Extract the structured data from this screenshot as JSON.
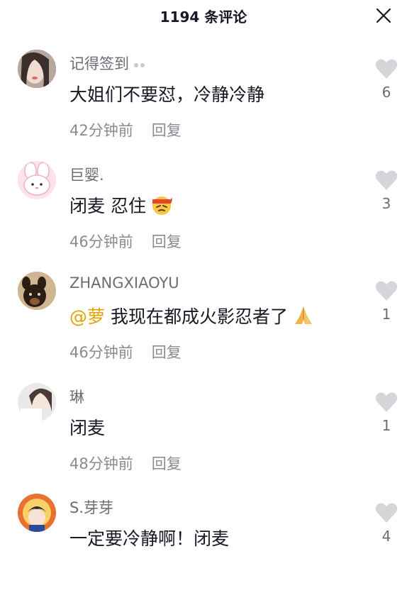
{
  "header": {
    "title": "1194 条评论"
  },
  "comments": [
    {
      "username": "记得签到",
      "text": "大姐们不要怼，冷静冷静",
      "time": "42分钟前",
      "reply": "回复",
      "likes": "6"
    },
    {
      "username": "巨婴.",
      "text": "闭麦 忍住",
      "time": "46分钟前",
      "reply": "回复",
      "likes": "3"
    },
    {
      "username": "ZHANGXIAOYU",
      "mention": "@萝",
      "text": "我现在都成火影忍者了",
      "time": "46分钟前",
      "reply": "回复",
      "likes": "1"
    },
    {
      "username": "琳",
      "text": "闭麦",
      "time": "48分钟前",
      "reply": "回复",
      "likes": "1"
    },
    {
      "username": "S.芽芽",
      "text": "一定要冷静啊！闭麦",
      "likes": "4"
    }
  ],
  "colors": {
    "mention": "#e0a400",
    "heart": "#d5d6d9",
    "muted": "#8a8b91"
  }
}
